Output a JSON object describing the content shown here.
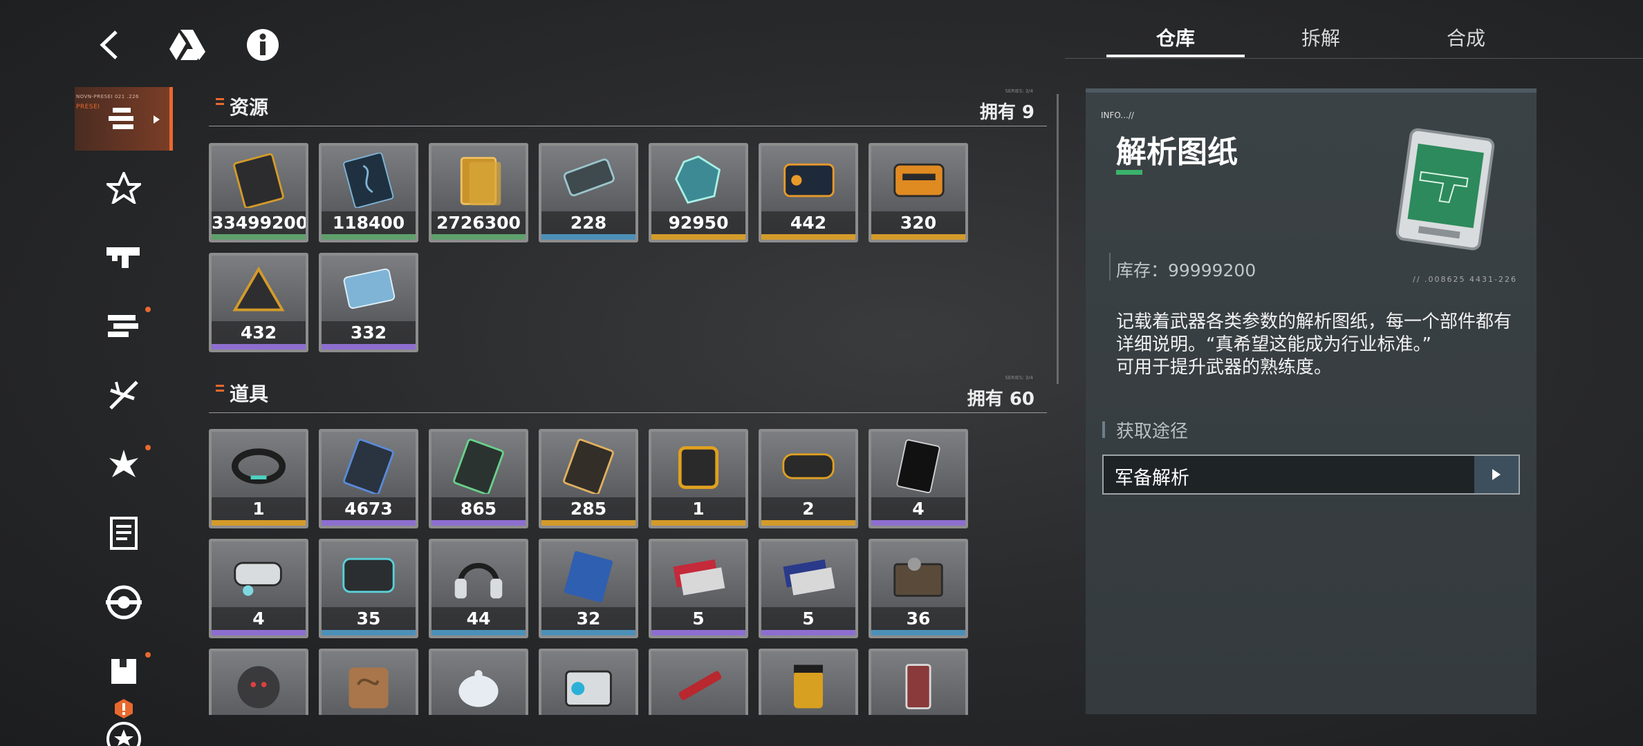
{
  "top": {
    "back_icon": "chevron-left-icon",
    "drive_icon": "triangle-logo-icon",
    "info_icon": "info-circle-icon"
  },
  "sidebar": {
    "active_caption": "NOVN-PRESEI 021 .226",
    "active_caption2": "PRESEI",
    "items": [
      {
        "icon": "stack-icon"
      },
      {
        "icon": "star-burst-icon"
      },
      {
        "icon": "gun-icon"
      },
      {
        "icon": "parts-icon"
      },
      {
        "icon": "sword-cross-icon"
      },
      {
        "icon": "flower-icon"
      },
      {
        "icon": "document-icon"
      },
      {
        "icon": "disc-icon"
      },
      {
        "icon": "box-icon"
      },
      {
        "icon": "alert-icon"
      },
      {
        "icon": "star-badge-icon"
      }
    ]
  },
  "resources": {
    "title": "资源",
    "owned": "拥有 9",
    "micro": "SERIES: 3/4",
    "items": [
      {
        "count": "33499200",
        "rarity": "green",
        "art": "gold-card"
      },
      {
        "count": "118400",
        "rarity": "green",
        "art": "dna-card"
      },
      {
        "count": "2726300",
        "rarity": "green",
        "art": "gold-bar"
      },
      {
        "count": "228",
        "rarity": "blue",
        "art": "usb-drive"
      },
      {
        "count": "92950",
        "rarity": "gold",
        "art": "crystal"
      },
      {
        "count": "442",
        "rarity": "gold",
        "art": "chip-card"
      },
      {
        "count": "320",
        "rarity": "gold",
        "art": "chip-card-orange"
      },
      {
        "count": "432",
        "rarity": "purple",
        "art": "triangle-module"
      },
      {
        "count": "332",
        "rarity": "purple",
        "art": "blue-card"
      }
    ]
  },
  "props": {
    "title": "道具",
    "owned": "拥有 60",
    "micro": "SERIES: 3/4",
    "items": [
      {
        "count": "1",
        "rarity": "gold",
        "art": "bracelet"
      },
      {
        "count": "4673",
        "rarity": "purple",
        "art": "blueprint-blue"
      },
      {
        "count": "865",
        "rarity": "purple",
        "art": "blueprint-green"
      },
      {
        "count": "285",
        "rarity": "gold",
        "art": "blueprint-gold"
      },
      {
        "count": "1",
        "rarity": "gold",
        "art": "device"
      },
      {
        "count": "2",
        "rarity": "gold",
        "art": "gamepad"
      },
      {
        "count": "4",
        "rarity": "purple",
        "art": "black-card"
      },
      {
        "count": "4",
        "rarity": "purple",
        "art": "vr-headset"
      },
      {
        "count": "35",
        "rarity": "blue",
        "art": "handheld"
      },
      {
        "count": "44",
        "rarity": "blue",
        "art": "headphones"
      },
      {
        "count": "32",
        "rarity": "blue",
        "art": "poster"
      },
      {
        "count": "5",
        "rarity": "purple",
        "art": "red-ticket"
      },
      {
        "count": "5",
        "rarity": "purple",
        "art": "blue-ticket"
      },
      {
        "count": "36",
        "rarity": "blue",
        "art": "tool-case"
      },
      {
        "count": "",
        "rarity": "none",
        "art": "robot"
      },
      {
        "count": "",
        "rarity": "none",
        "art": "cookie"
      },
      {
        "count": "",
        "rarity": "none",
        "art": "teapot"
      },
      {
        "count": "",
        "rarity": "none",
        "art": "speaker"
      },
      {
        "count": "",
        "rarity": "none",
        "art": "lipstick"
      },
      {
        "count": "",
        "rarity": "none",
        "art": "jar"
      },
      {
        "count": "",
        "rarity": "none",
        "art": "lighter"
      }
    ]
  },
  "tabs": [
    {
      "label": "仓库",
      "active": true
    },
    {
      "label": "拆解",
      "active": false
    },
    {
      "label": "合成",
      "active": false
    }
  ],
  "detail": {
    "info_tag": "INFO...//",
    "name": "解析图纸",
    "stock": "库存：99999200",
    "code": "// .008625   4431-226",
    "description": "记载着武器各类参数的解析图纸，每一个部件都有详细说明。“真希望这能成为行业标准。”\n可用于提升武器的熟练度。",
    "source_title": "获取途径",
    "source_entry": "军备解析"
  },
  "colors": {
    "accent": "#e8692e",
    "green": "#5fa06c",
    "blue": "#4c90b8",
    "gold": "#d39b2a",
    "purple": "#8d6ed0"
  }
}
